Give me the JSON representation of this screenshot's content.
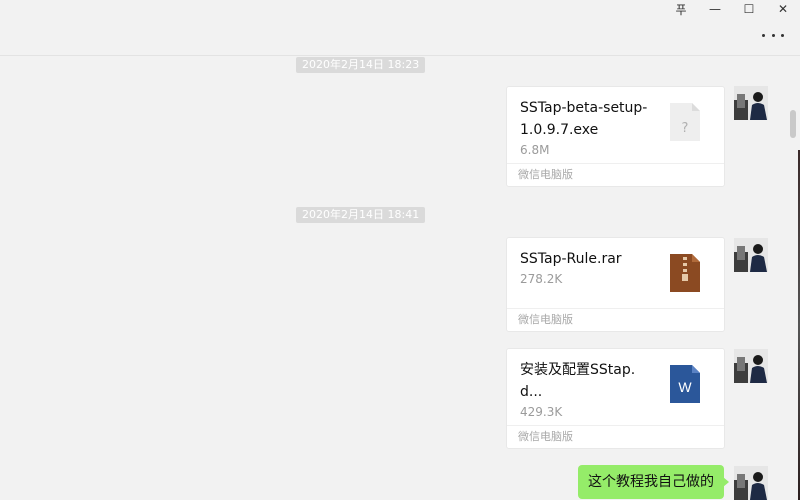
{
  "window": {
    "controls": {
      "pin_glyph": "푸",
      "minimize_glyph": "—",
      "maximize_glyph": "☐",
      "close_glyph": "✕"
    }
  },
  "messages": [
    {
      "type": "timestamp",
      "text": "2020年2月14日 18:23"
    },
    {
      "type": "file",
      "name": "SSTap-beta-setup-1.0.9.7.exe",
      "size": "6.8M",
      "footer": "微信电脑版",
      "icon": "unknown-file-icon"
    },
    {
      "type": "timestamp",
      "text": "2020年2月14日 18:41"
    },
    {
      "type": "file",
      "name": "SSTap-Rule.rar",
      "size": "278.2K",
      "footer": "微信电脑版",
      "icon": "archive-file-icon"
    },
    {
      "type": "file",
      "name": "安装及配置SStap.d...",
      "size": "429.3K",
      "footer": "微信电脑版",
      "icon": "word-document-icon",
      "icon_letter": "W"
    },
    {
      "type": "text",
      "text": "这个教程我自己做的"
    }
  ],
  "colors": {
    "background": "#f2f2f2",
    "bubble_green": "#95ec69",
    "archive_brown": "#8b4a22",
    "word_blue": "#2b579a",
    "unknown_gray": "#eeeeee"
  }
}
